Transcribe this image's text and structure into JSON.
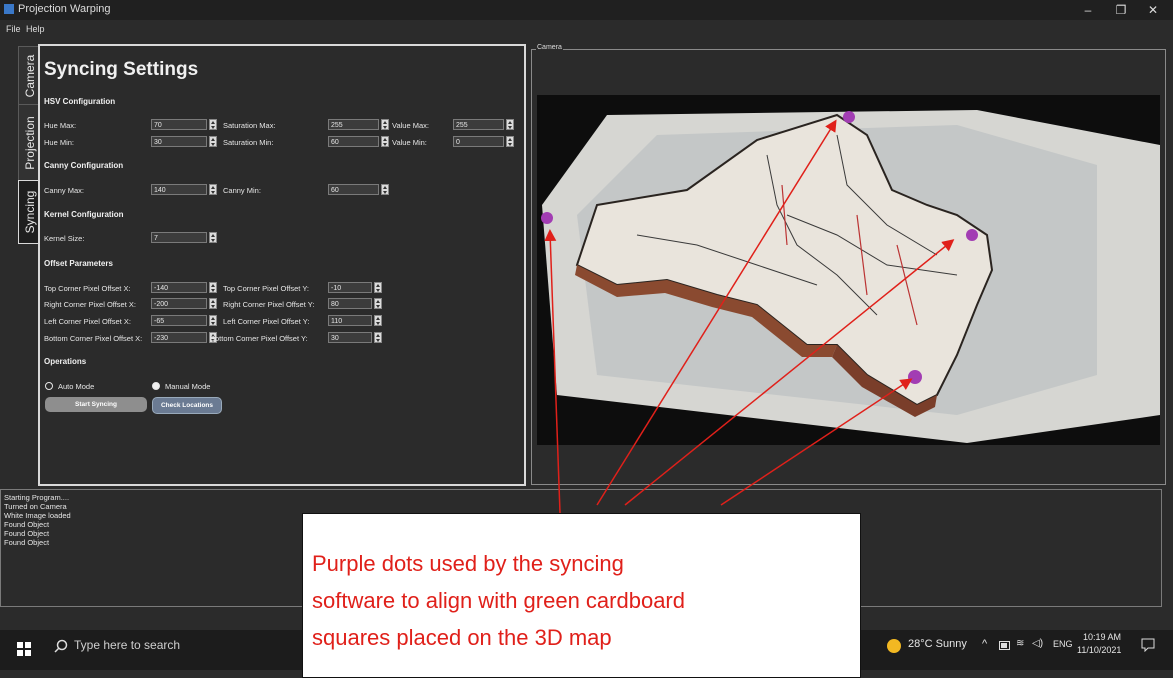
{
  "window": {
    "title": "Projection Warping",
    "minimize": "–",
    "restore": "❐",
    "close": "✕"
  },
  "menu": [
    "File",
    "Help"
  ],
  "tabs": [
    "Camera",
    "Projection",
    "Syncing"
  ],
  "settings": {
    "title": "Syncing Settings",
    "hsv": {
      "heading": "HSV Configuration",
      "hue_max_label": "Hue Max:",
      "hue_max": "70",
      "hue_min_label": "Hue Min:",
      "hue_min": "30",
      "sat_max_label": "Saturation Max:",
      "sat_max": "255",
      "sat_min_label": "Saturation Min:",
      "sat_min": "60",
      "val_max_label": "Value Max:",
      "val_max": "255",
      "val_min_label": "Value Min:",
      "val_min": "0"
    },
    "canny": {
      "heading": "Canny Configuration",
      "max_label": "Canny Max:",
      "max": "140",
      "min_label": "Canny Min:",
      "min": "60"
    },
    "kernel": {
      "heading": "Kernel Configuration",
      "size_label": "Kernel Size:",
      "size": "7"
    },
    "offset": {
      "heading": "Offset Parameters",
      "top_x_label": "Top Corner Pixel Offset X:",
      "top_x": "-140",
      "top_y_label": "Top Corner Pixel Offset Y:",
      "top_y": "-10",
      "right_x_label": "Right Corner Pixel Offset X:",
      "right_x": "-200",
      "right_y_label": "Right Corner Pixel Offset Y:",
      "right_y": "80",
      "left_x_label": "Left Corner Pixel Offset X:",
      "left_x": "-65",
      "left_y_label": "Left Corner Pixel Offset Y:",
      "left_y": "110",
      "bottom_x_label": "Bottom Corner Pixel Offset X:",
      "bottom_x": "-230",
      "bottom_y_label": "Bottom Corner Pixel Offset Y:",
      "bottom_y": "30"
    },
    "operations": {
      "heading": "Operations",
      "auto_label": "Auto Mode",
      "manual_label": "Manual Mode",
      "selected": "manual",
      "start_label": "Start Syncing",
      "check_label": "Check Locations"
    }
  },
  "camera": {
    "legend": "Camera"
  },
  "log": [
    "Starting Program....",
    "Turned on Camera",
    "White Image loaded",
    "Found Object",
    "Found Object",
    "Found Object"
  ],
  "taskbar": {
    "search_placeholder": "Type here to search",
    "weather": "28°C  Sunny",
    "lang": "ENG",
    "time": "10:19 AM",
    "date": "11/10/2021"
  },
  "callout": {
    "lines": [
      "Purple dots used by the syncing",
      "software to align with green cardboard",
      "squares placed on the 3D map"
    ]
  }
}
